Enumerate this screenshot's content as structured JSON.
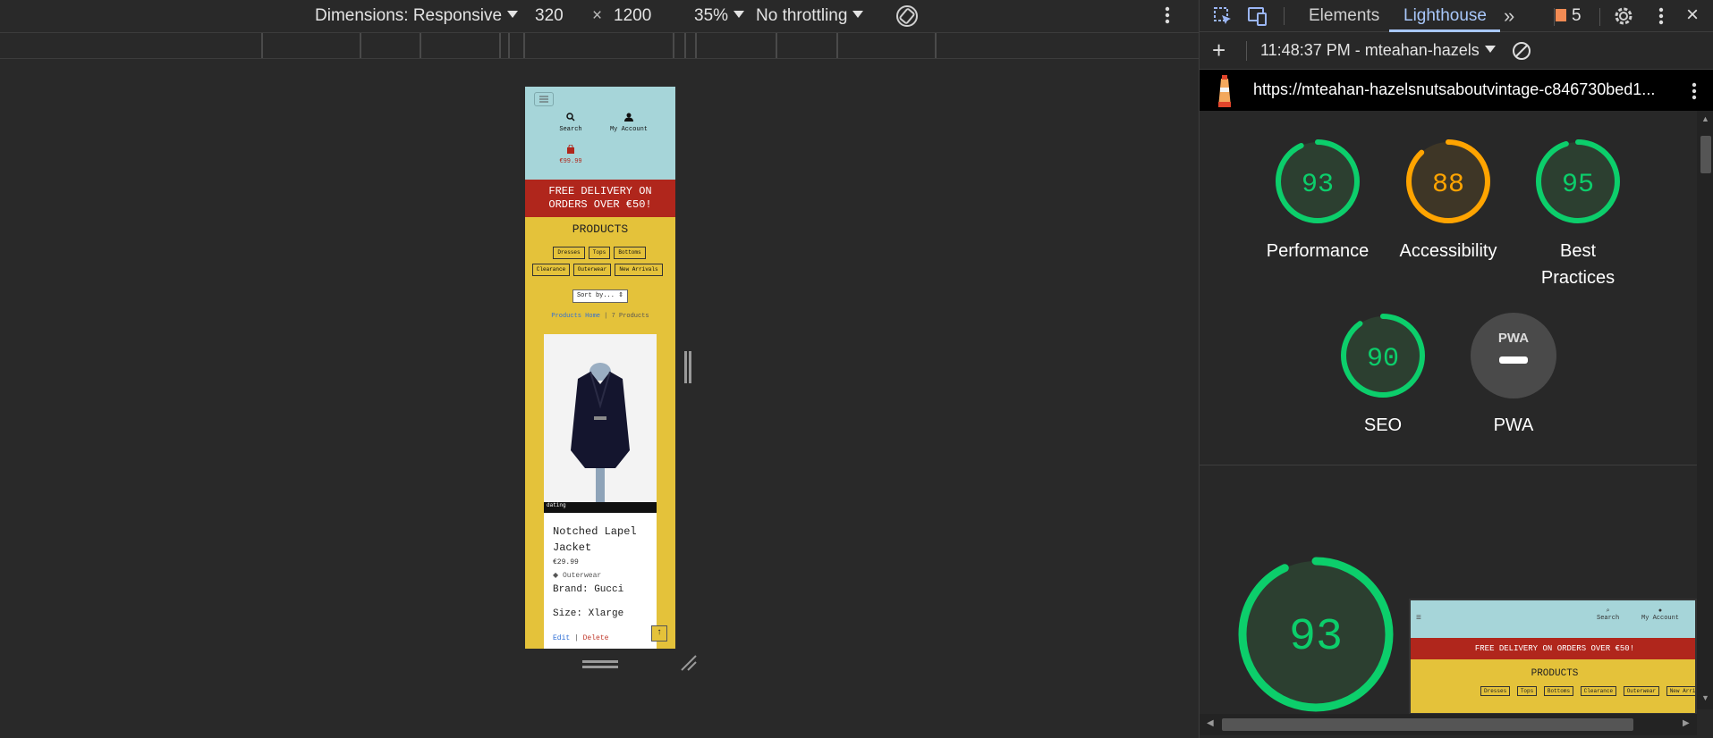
{
  "device_toolbar": {
    "dimensions_label": "Dimensions: Responsive",
    "width_value": "320",
    "times": "×",
    "height_value": "1200",
    "zoom_label": "35%",
    "throttling_label": "No throttling"
  },
  "page": {
    "nav": {
      "search_label": "Search",
      "account_label": "My Account",
      "cart_total": "€99.99"
    },
    "banner_line1": "FREE DELIVERY ON",
    "banner_line2": "ORDERS OVER €50!",
    "heading": "PRODUCTS",
    "categories_row1": [
      "Dresses",
      "Tops",
      "Bottoms"
    ],
    "categories_row2": [
      "Clearance",
      "Outerwear",
      "New Arrivals"
    ],
    "sort_label": "Sort by... ⇕",
    "breadcrumb_link": "Products Home",
    "breadcrumb_sep": " | ",
    "product_count": "7 Products",
    "product": {
      "name_line1": "Notched Lapel",
      "name_line2": "Jacket",
      "price": "€29.99",
      "category": "Outerwear",
      "brand": "Brand: Gucci",
      "size": "Size: Xlarge",
      "edit_label": "Edit",
      "sep": " | ",
      "delete_label": "Delete",
      "image_caption": "dating"
    }
  },
  "devtools": {
    "tabs": {
      "elements": "Elements",
      "lighthouse": "Lighthouse",
      "issues_count": "5"
    },
    "report_selector": "11:48:37 PM - mteahan-hazels",
    "url": "https://mteahan-hazelsnutsaboutvintage-c846730bed1...",
    "scores": [
      {
        "label_line1": "Performance",
        "label_line2": "",
        "value": "93",
        "color": "#0cce6b"
      },
      {
        "label_line1": "Accessibility",
        "label_line2": "",
        "value": "88",
        "color": "#ffa400"
      },
      {
        "label_line1": "Best",
        "label_line2": "Practices",
        "value": "95",
        "color": "#0cce6b"
      },
      {
        "label_line1": "SEO",
        "label_line2": "",
        "value": "90",
        "color": "#0cce6b"
      },
      {
        "label_line1": "PWA",
        "label_line2": "",
        "value": "",
        "color": "#9e9e9e"
      }
    ],
    "pwa_badge": "PWA",
    "big_score": "93",
    "preview": {
      "banner": "FREE DELIVERY ON ORDERS OVER €50!",
      "heading": "PRODUCTS",
      "search_label": "Search",
      "account_label": "My Account",
      "categories": [
        "Dresses",
        "Tops",
        "Bottoms",
        "Clearance",
        "Outerwear",
        "New Arrivals"
      ]
    }
  }
}
